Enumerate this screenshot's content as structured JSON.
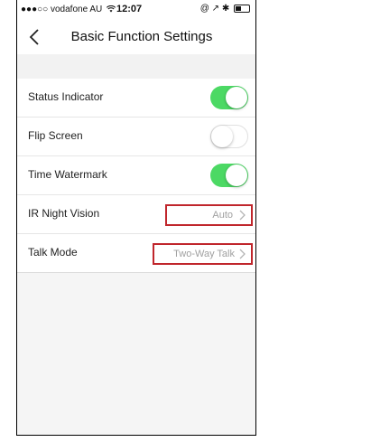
{
  "status_bar": {
    "carrier": "●●●○○ vodafone AU",
    "wifi_icon": "wifi-icon",
    "time": "12:07",
    "right_icons": "@ ↗ ✱"
  },
  "nav": {
    "title": "Basic Function Settings",
    "back_icon": "chevron-left-icon"
  },
  "settings": [
    {
      "label": "Status Indicator",
      "type": "toggle",
      "on": true
    },
    {
      "label": "Flip Screen",
      "type": "toggle",
      "on": false
    },
    {
      "label": "Time Watermark",
      "type": "toggle",
      "on": true
    },
    {
      "label": "IR Night Vision",
      "type": "value",
      "value": "Auto"
    },
    {
      "label": "Talk Mode",
      "type": "value",
      "value": "Two-Way Talk"
    }
  ],
  "colors": {
    "toggle_on": "#4cd964",
    "highlight_box": "#c0262c",
    "value_text": "#a0a0a0"
  }
}
